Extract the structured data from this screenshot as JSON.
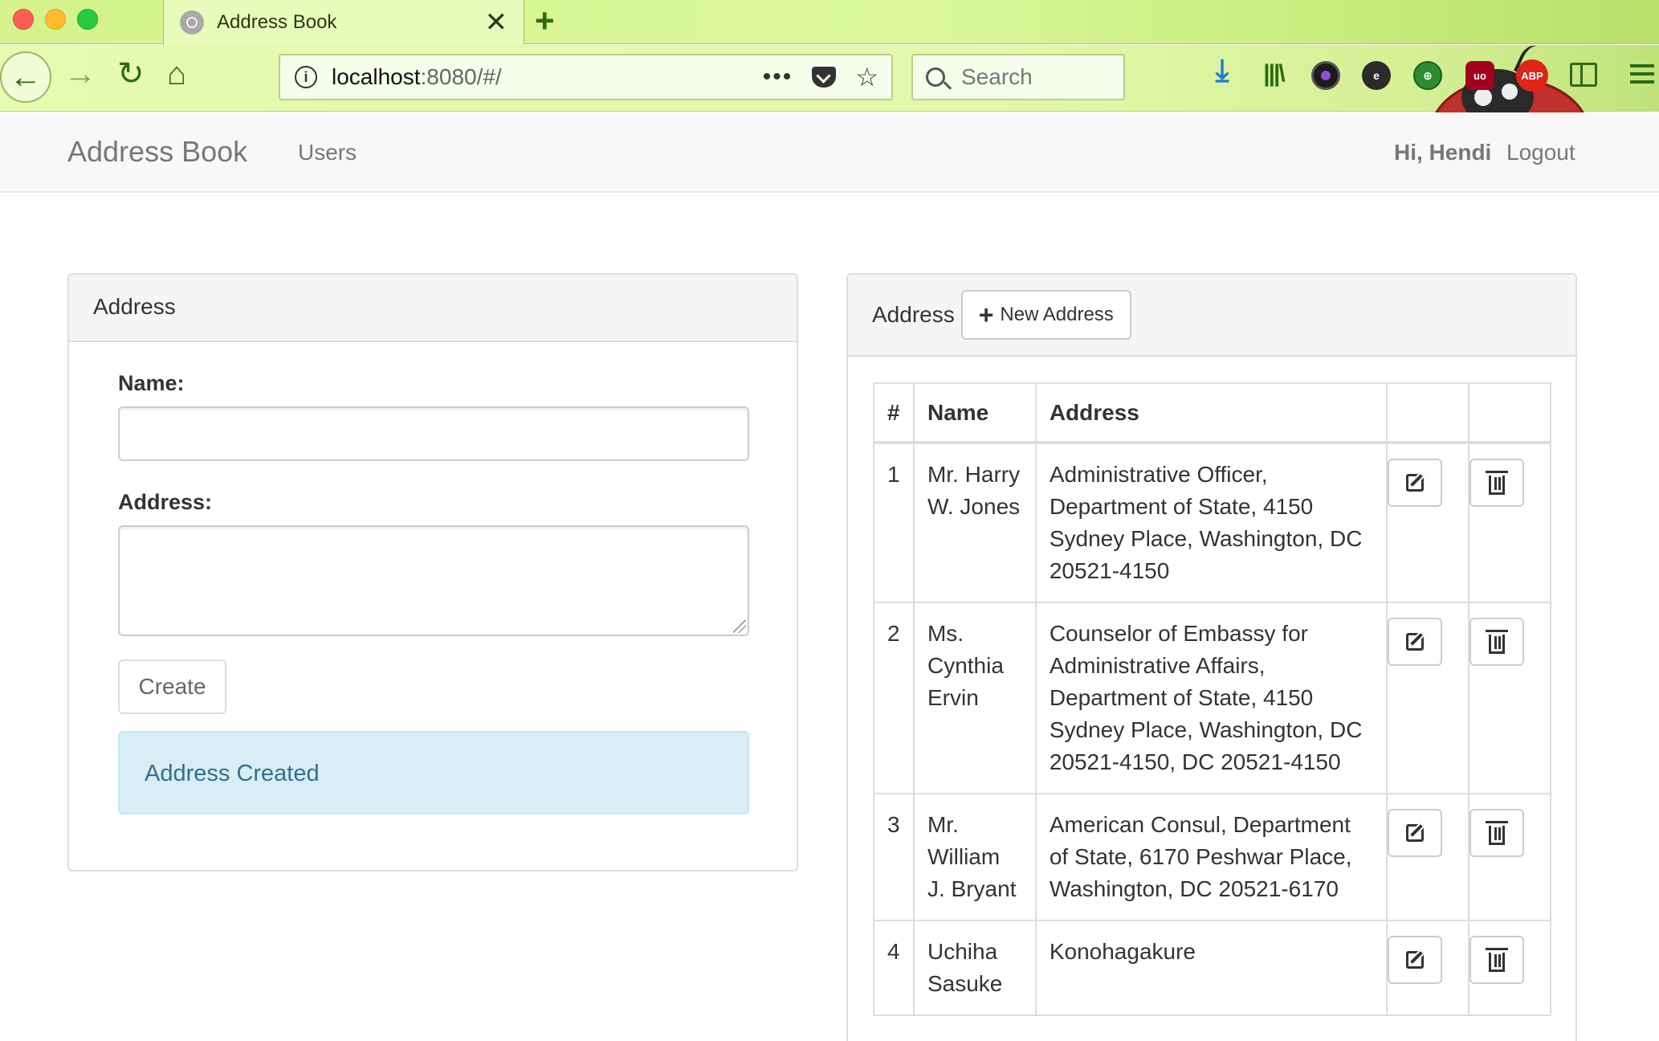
{
  "browser": {
    "tab_title": "Address Book",
    "tab_close": "✕",
    "new_tab": "+",
    "url_host": "localhost",
    "url_rest": ":8080/#/",
    "url_more": "•••",
    "search_placeholder": "Search",
    "abp_label": "ABP",
    "ublock_label": "uo"
  },
  "app": {
    "brand": "Address Book",
    "nav_users": "Users",
    "greeting": "Hi, Hendi",
    "logout": "Logout"
  },
  "form_panel": {
    "title": "Address",
    "name_label": "Name:",
    "name_value": "",
    "address_label": "Address:",
    "address_value": "",
    "create_button": "Create",
    "alert": "Address Created"
  },
  "list_panel": {
    "title": "Address",
    "new_button": "New Address",
    "columns": [
      "#",
      "Name",
      "Address",
      "",
      ""
    ],
    "rows": [
      {
        "num": "1",
        "name": "Mr. Harry W. Jones",
        "address": "Administrative Officer, Department of State, 4150 Sydney Place, Washington, DC 20521-4150"
      },
      {
        "num": "2",
        "name": "Ms. Cynthia Ervin",
        "address": "Counselor of Embassy for Administrative Affairs, Department of State, 4150 Sydney Place, Washington, DC 20521-4150, DC 20521-4150"
      },
      {
        "num": "3",
        "name": "Mr. William J. Bryant",
        "address": "American Consul, Department of State, 6170 Peshwar Place, Washington, DC 20521-6170"
      },
      {
        "num": "4",
        "name": "Uchiha Sasuke",
        "address": "Konohagakure"
      }
    ]
  },
  "icons": {
    "edit": "edit-icon",
    "delete": "trash-icon",
    "plus": "plus-icon"
  },
  "colors": {
    "alert_bg": "#d9edf7",
    "alert_text": "#31708f",
    "chrome_green": "#d4f38c"
  }
}
